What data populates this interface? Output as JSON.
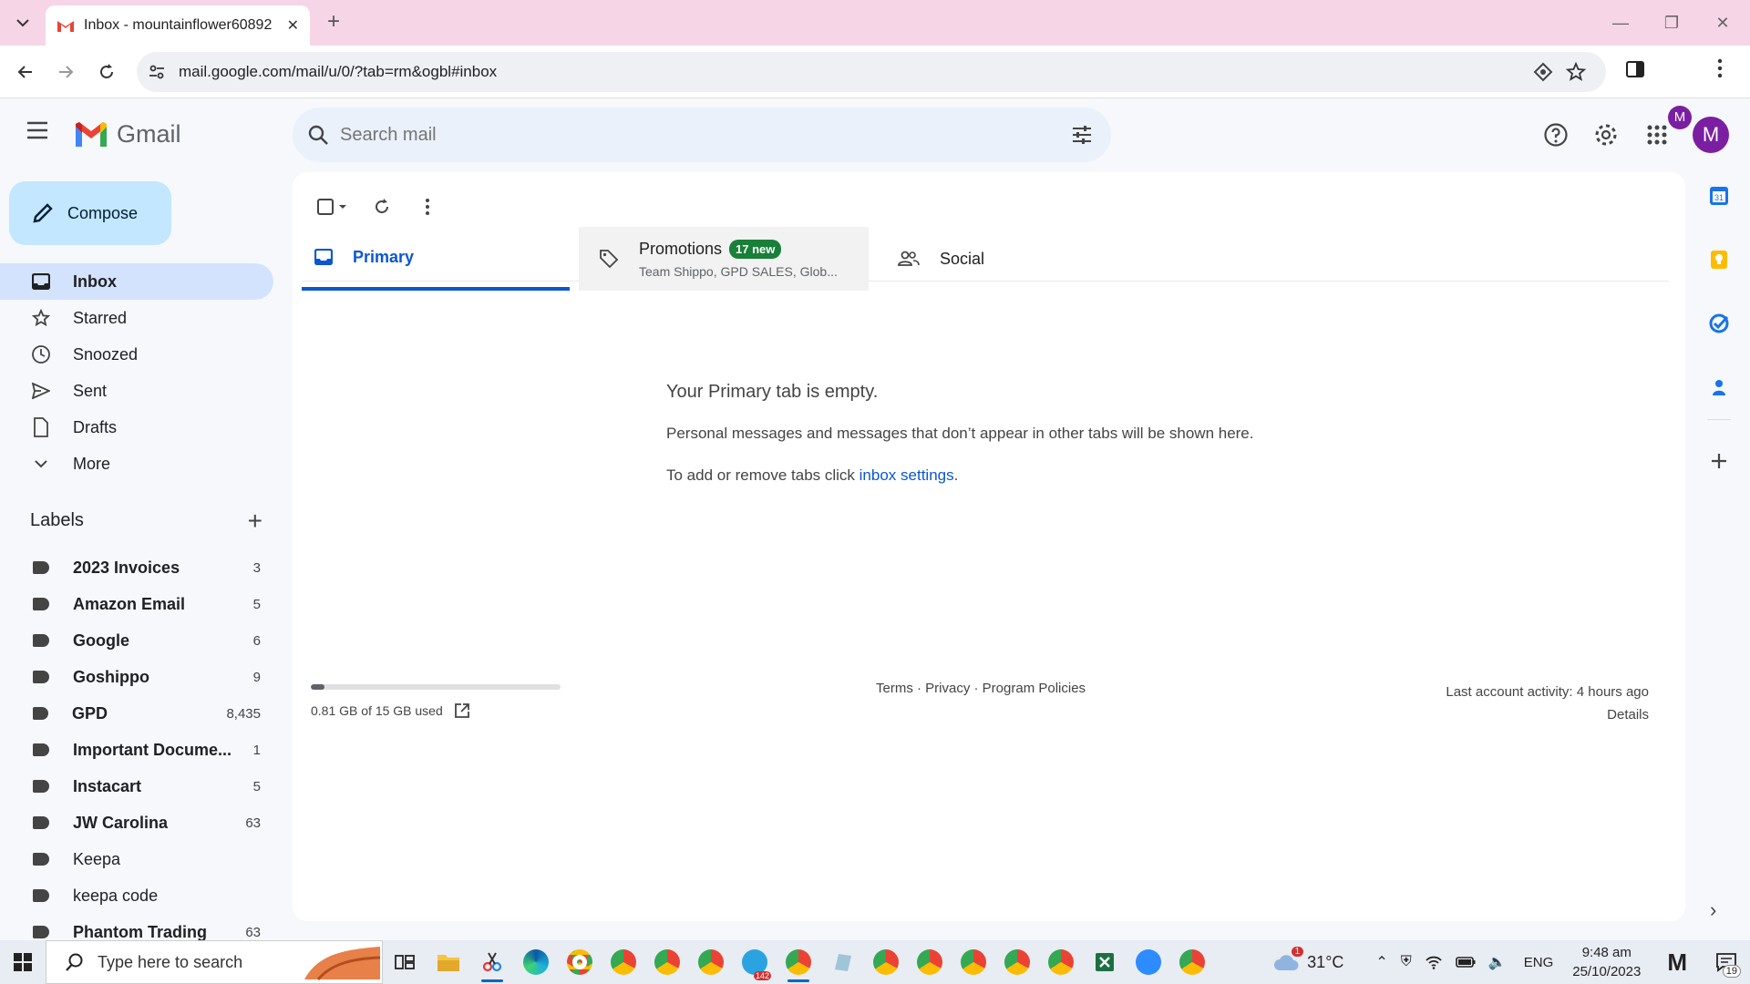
{
  "browser": {
    "tab_title": "Inbox - mountainflower60892",
    "url": "mail.google.com/mail/u/0/?tab=rm&ogbl#inbox",
    "profile_initial": "M"
  },
  "gmail": {
    "brand": "Gmail",
    "search_placeholder": "Search mail",
    "avatar_initial": "M"
  },
  "sidebar": {
    "compose_label": "Compose",
    "nav": [
      {
        "label": "Inbox",
        "icon": "inbox-icon"
      },
      {
        "label": "Starred",
        "icon": "star-icon"
      },
      {
        "label": "Snoozed",
        "icon": "clock-icon"
      },
      {
        "label": "Sent",
        "icon": "send-icon"
      },
      {
        "label": "Drafts",
        "icon": "draft-icon"
      },
      {
        "label": "More",
        "icon": "chevron-down-icon"
      }
    ],
    "labels_title": "Labels",
    "labels": [
      {
        "name": "2023 Invoices",
        "count": "3"
      },
      {
        "name": "Amazon Email",
        "count": "5"
      },
      {
        "name": "Google",
        "count": "6"
      },
      {
        "name": "Goshippo",
        "count": "9"
      },
      {
        "name": "GPD",
        "count": "8,435"
      },
      {
        "name": "Important Docume...",
        "count": "1"
      },
      {
        "name": "Instacart",
        "count": "5"
      },
      {
        "name": "JW Carolina",
        "count": "63"
      },
      {
        "name": "Keepa",
        "count": ""
      },
      {
        "name": "keepa code",
        "count": ""
      },
      {
        "name": "Phantom Trading",
        "count": "63"
      }
    ]
  },
  "tabs": {
    "primary": "Primary",
    "promotions": "Promotions",
    "promotions_badge": "17 new",
    "promotions_senders": "Team Shippo, GPD SALES, Glob...",
    "social": "Social"
  },
  "empty_state": {
    "heading": "Your Primary tab is empty.",
    "line1": "Personal messages and messages that don’t appear in other tabs will be shown here.",
    "line2_prefix": "To add or remove tabs click ",
    "line2_link": "inbox settings",
    "line2_suffix": "."
  },
  "footer": {
    "storage_text": "0.81 GB of 15 GB used",
    "storage_fraction": 0.054,
    "links": "Terms · Privacy · Program Policies",
    "activity": "Last account activity: 4 hours ago",
    "details": "Details"
  },
  "taskbar": {
    "search_placeholder": "Type here to search",
    "telegram_badge": "142",
    "weather": "31°C",
    "weather_alert": "1",
    "lang": "ENG",
    "time": "9:48 am",
    "date": "25/10/2023",
    "notifications": "19"
  },
  "colors": {
    "accent": "#0b57d0",
    "compose_bg": "#c2e7ff",
    "active_nav": "#d3e3fd",
    "badge_green": "#188038"
  }
}
